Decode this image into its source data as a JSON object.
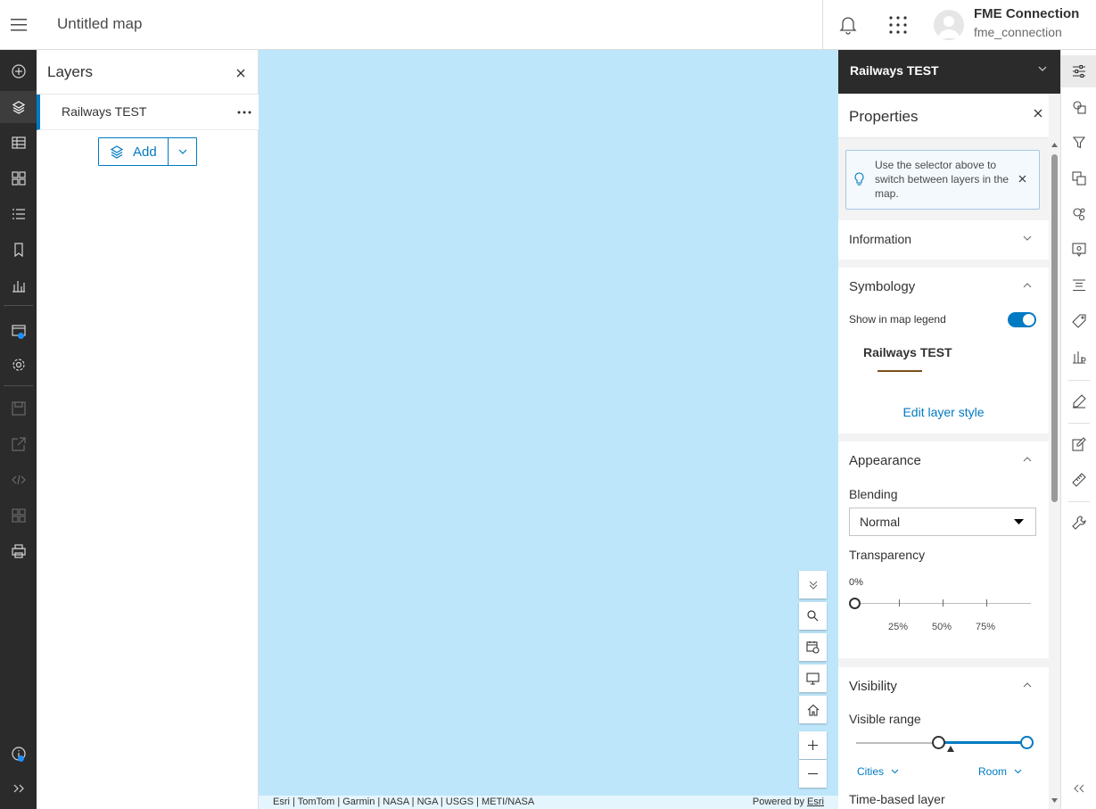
{
  "header": {
    "map_title": "Untitled map",
    "user_name": "FME Connection",
    "user_handle": "fme_connection"
  },
  "left_toolbar": {
    "items": [
      "add-icon",
      "layers-icon",
      "table-icon",
      "basemap-icon",
      "legend-icon",
      "bookmark-icon",
      "chart-icon",
      "map-properties-icon",
      "settings-icon",
      "save-icon",
      "share-icon",
      "embed-icon",
      "create-app-icon",
      "print-icon",
      "info-icon",
      "expand-icon"
    ],
    "active": "layers-icon"
  },
  "layers_panel": {
    "title": "Layers",
    "layers": [
      {
        "name": "Railways TEST"
      }
    ],
    "add_label": "Add"
  },
  "map": {
    "background_color": "#bee6fa",
    "attribution": "Esri | TomTom | Garmin | NASA | NGA | USGS | METI/NASA",
    "powered_by": "Powered by",
    "powered_by_link": "Esri"
  },
  "properties_panel": {
    "layer_selector": "Railways TEST",
    "title": "Properties",
    "tip": "Use the selector above to switch between layers in the map.",
    "information": "Information",
    "symbology": {
      "title": "Symbology",
      "show_in_legend_label": "Show in map legend",
      "show_in_legend": true,
      "layer_name": "Railways TEST",
      "line_color": "#7a4f1c",
      "edit_style": "Edit layer style"
    },
    "appearance": {
      "title": "Appearance",
      "blending_label": "Blending",
      "blending_value": "Normal",
      "transparency_label": "Transparency",
      "transparency_value": "0%",
      "transparency_ticks": [
        "25%",
        "50%",
        "75%"
      ]
    },
    "visibility": {
      "title": "Visibility",
      "visible_range_label": "Visible range",
      "min_scale": "Cities",
      "max_scale": "Room",
      "time_based_label": "Time-based layer"
    }
  },
  "right_toolbar": {
    "items": [
      "properties-icon",
      "styles-icon",
      "filter-icon",
      "effects-icon",
      "pop-ups-icon",
      "configure-popups-icon",
      "fields-icon",
      "labels-icon",
      "charts-icon",
      "sketch-icon",
      "edit-icon",
      "measure-icon",
      "tools-icon",
      "collapse-icon"
    ],
    "active": "properties-icon"
  },
  "colors": {
    "accent": "#007ac2",
    "dark_bar": "#2b2b2b"
  }
}
